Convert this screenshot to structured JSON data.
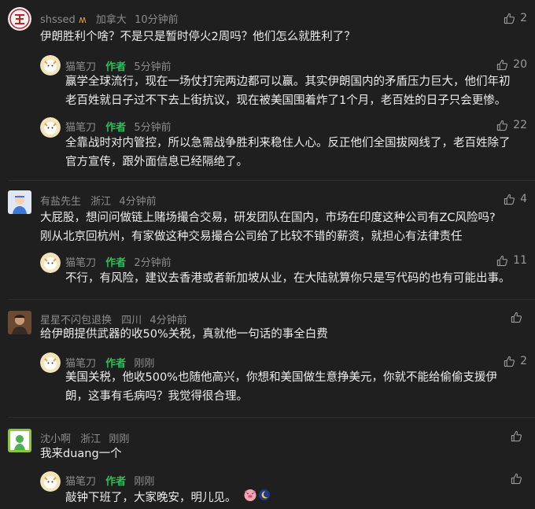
{
  "comments": [
    {
      "user": "shssed",
      "location": "加拿大",
      "time": "10分钟前",
      "likes": "2",
      "text": "伊朗胜利个啥？不是只是暂时停火2周吗？他们怎么就胜利了？",
      "replies": [
        {
          "user": "猫笔刀",
          "badge": "作者",
          "time": "5分钟前",
          "likes": "20",
          "lines": [
            "赢学全球流行，现在一场仗打完两边都可以赢。其实伊朗国内的矛盾压力巨大，他们年初",
            "老百姓就日子过不下去上街抗议，现在被美国围着炸了1个月，老百姓的日子只会更惨。"
          ]
        },
        {
          "user": "猫笔刀",
          "badge": "作者",
          "time": "5分钟前",
          "likes": "22",
          "lines": [
            "全靠战时对内管控，所以急需战争胜利来稳住人心。反正他们全国拔网线了，老百姓除了",
            "官方宣传，跟外面信息已经隔绝了。"
          ]
        }
      ]
    },
    {
      "user": "有盐先生",
      "location": "浙江",
      "time": "4分钟前",
      "likes": "4",
      "lines": [
        "大屁股，想问问做链上赌场撮合交易，研发团队在国内，市场在印度这种公司有ZC风险吗?",
        "刚从北京回杭州，有家做这种交易撮合公司给了比较不错的薪资，就担心有法律责任"
      ],
      "replies": [
        {
          "user": "猫笔刀",
          "badge": "作者",
          "time": "2分钟前",
          "likes": "11",
          "lines": [
            "不行，有风险，建议去香港或者新加坡从业，在大陆就算你只是写代码的也有可能出事。"
          ]
        }
      ]
    },
    {
      "user": "星星不闪包退换",
      "location": "四川",
      "time": "4分钟前",
      "likes": "",
      "text": "给伊朗提供武器的收50%关税，真就他一句话的事全白费",
      "replies": [
        {
          "user": "猫笔刀",
          "badge": "作者",
          "time": "刚刚",
          "likes": "2",
          "lines": [
            "美国关税，他收500%也随他高兴，你想和美国做生意挣美元，你就不能给偷偷支援伊",
            "朗，这事有毛病吗？我觉得很合理。"
          ]
        }
      ]
    },
    {
      "user": "沈小啊",
      "location": "浙江",
      "time": "刚刚",
      "likes": "",
      "text": "我来duang一个",
      "replies": [
        {
          "user": "猫笔刀",
          "badge": "作者",
          "time": "刚刚",
          "likes": "",
          "lines": [
            "敲钟下班了，大家晚安，明儿见。"
          ],
          "emojis": [
            "pig-emoji",
            "moon-emoji"
          ]
        }
      ]
    }
  ]
}
